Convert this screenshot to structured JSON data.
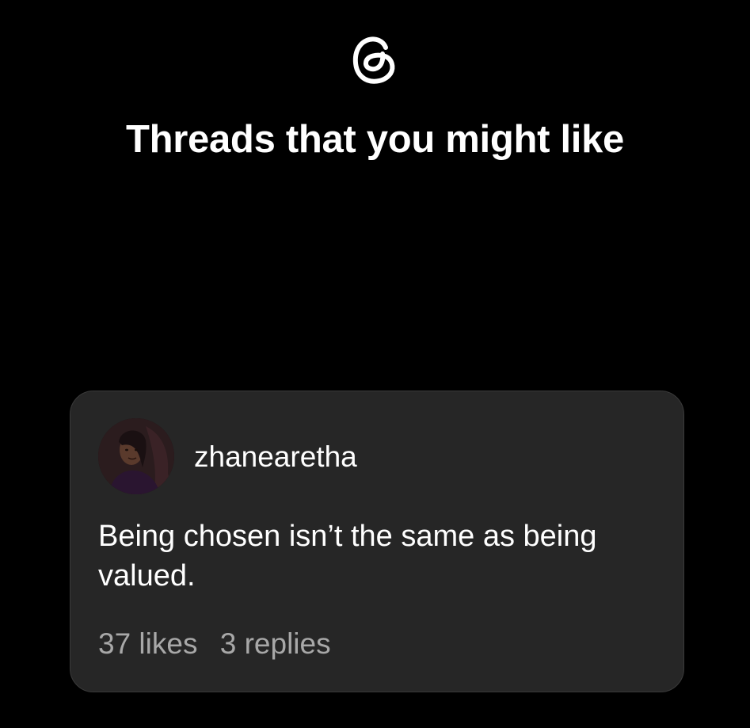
{
  "header": {
    "logo_icon": "threads-logo-icon",
    "title": "Threads that you might like"
  },
  "card": {
    "username": "zhanearetha",
    "avatar_icon": "user-avatar",
    "text": "Being chosen isn’t the same as being valued.",
    "likes": "37 likes",
    "replies": "3 replies"
  },
  "colors": {
    "background": "#000000",
    "card_background": "#262626",
    "secondary_text": "#a8a8a8",
    "primary_text": "#ffffff"
  }
}
